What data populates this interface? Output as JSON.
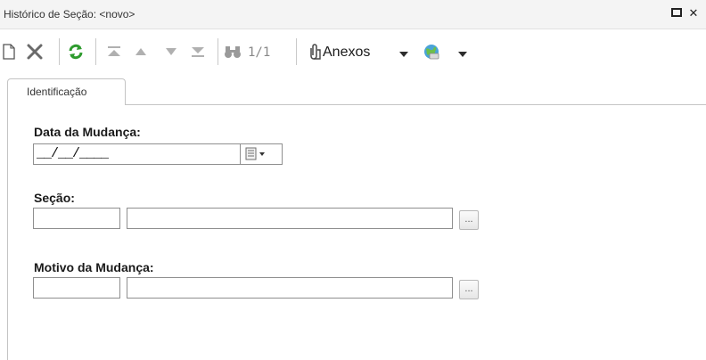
{
  "window": {
    "title": "Histórico de Seção: <novo>",
    "maximize_icon": "maximize-icon",
    "close_icon": "close-icon",
    "close_glyph": "✕"
  },
  "toolbar": {
    "pager_text": "1/1",
    "attachments_label": "Anexos",
    "icons": [
      "new-document-icon",
      "delete-icon",
      "refresh-icon",
      "first-record-icon",
      "previous-record-icon",
      "next-record-icon",
      "last-record-icon",
      "find-icon",
      "attachment-paperclip-icon",
      "globe-icon"
    ]
  },
  "tabs": [
    {
      "label": "Identificação",
      "active": true
    }
  ],
  "form": {
    "date_label": "Data da Mudança:",
    "date_value": "__/__/____",
    "section_label": "Seção:",
    "section_code": "",
    "section_name": "",
    "reason_label": "Motivo da Mudança:",
    "reason_code": "",
    "reason_name": "",
    "lookup_button_label": "..."
  },
  "colors": {
    "refresh_green": "#2e9b2e",
    "disabled_gray": "#b0b0b0",
    "border": "#8f8f8f"
  }
}
